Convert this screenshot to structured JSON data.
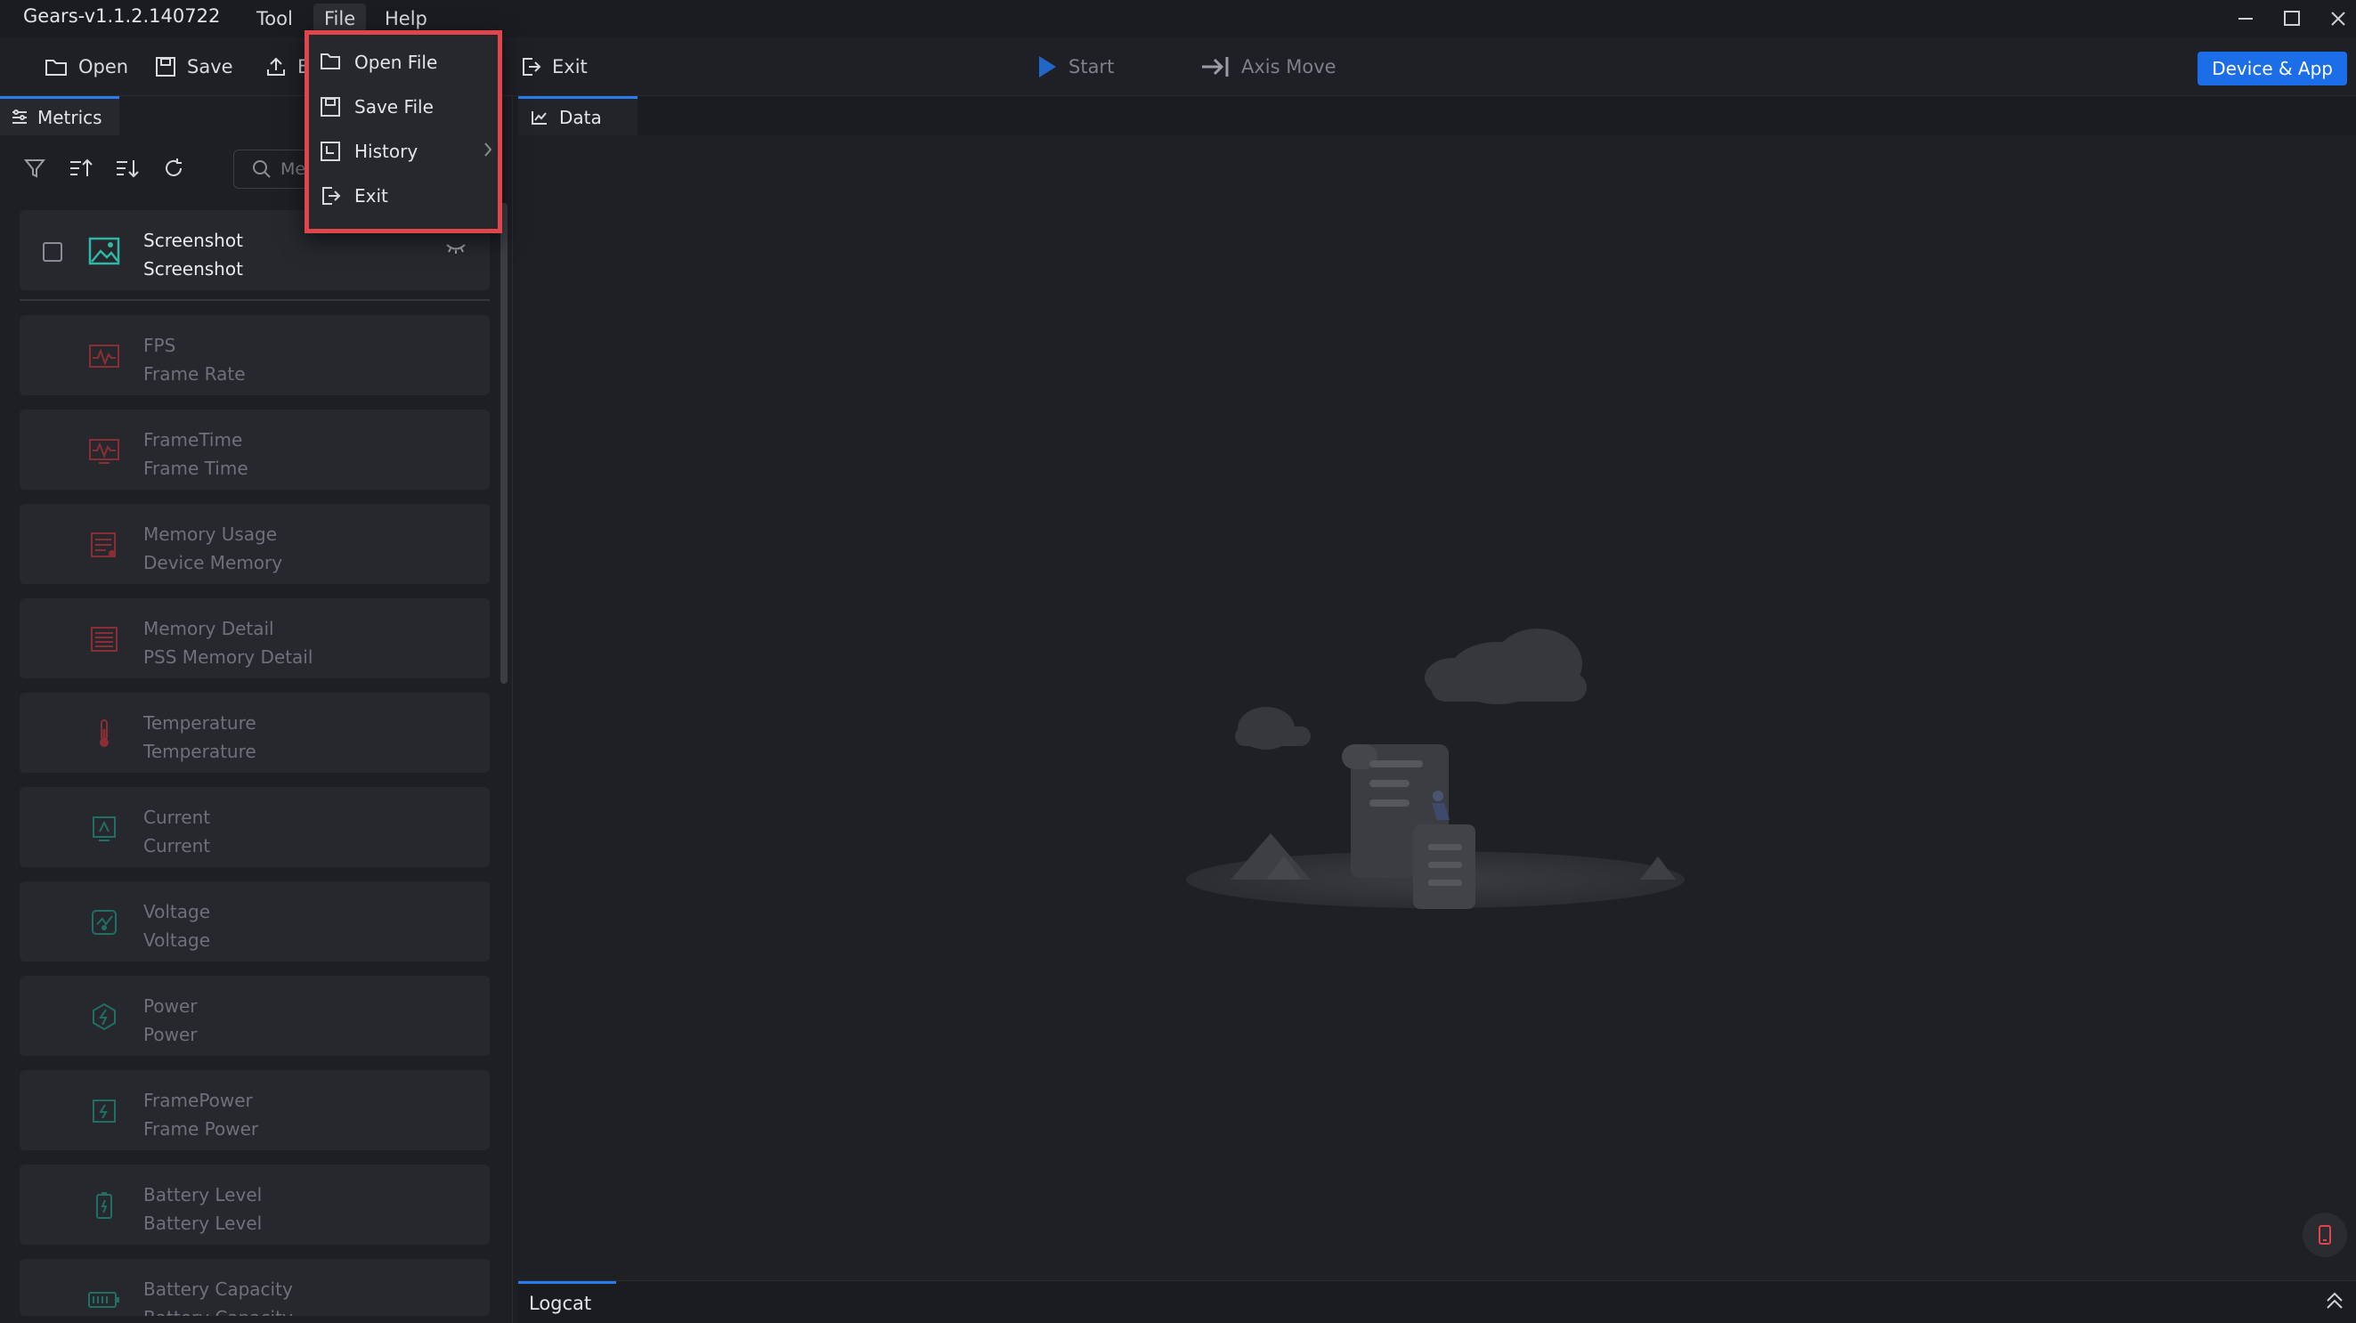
{
  "window": {
    "title": "Gears-v1.1.2.140722",
    "menus": [
      "Tool",
      "File",
      "Help"
    ],
    "active_menu": "File"
  },
  "toolbar": {
    "open": "Open",
    "save": "Save",
    "export_partial": "E",
    "exit": "Exit",
    "start": "Start",
    "axis_move": "Axis Move",
    "device_app": "Device & App"
  },
  "file_menu": {
    "items": [
      {
        "label": "Open File",
        "icon": "folder-icon"
      },
      {
        "label": "Save File",
        "icon": "save-icon"
      },
      {
        "label": "History",
        "icon": "history-icon",
        "has_submenu": true
      },
      {
        "label": "Exit",
        "icon": "exit-icon"
      }
    ]
  },
  "metrics_panel": {
    "tab_label": "Metrics",
    "search_placeholder": "Me",
    "items": [
      {
        "title": "Screenshot",
        "subtitle": "Screenshot",
        "enabled": true,
        "color": "#2fb8a6"
      },
      {
        "title": "FPS",
        "subtitle": "Frame Rate",
        "enabled": false,
        "color": "#c0444c"
      },
      {
        "title": "FrameTime",
        "subtitle": "Frame Time",
        "enabled": false,
        "color": "#c0444c"
      },
      {
        "title": "Memory Usage",
        "subtitle": "Device Memory",
        "enabled": false,
        "color": "#c0444c"
      },
      {
        "title": "Memory Detail",
        "subtitle": "PSS Memory Detail",
        "enabled": false,
        "color": "#c0444c"
      },
      {
        "title": "Temperature",
        "subtitle": "Temperature",
        "enabled": false,
        "color": "#c0444c"
      },
      {
        "title": "Current",
        "subtitle": "Current",
        "enabled": false,
        "color": "#1f8f80"
      },
      {
        "title": "Voltage",
        "subtitle": "Voltage",
        "enabled": false,
        "color": "#1f8f80"
      },
      {
        "title": "Power",
        "subtitle": "Power",
        "enabled": false,
        "color": "#1f8f80"
      },
      {
        "title": "FramePower",
        "subtitle": "Frame Power",
        "enabled": false,
        "color": "#1f8f80"
      },
      {
        "title": "Battery Level",
        "subtitle": "Battery Level",
        "enabled": false,
        "color": "#1f8f80"
      },
      {
        "title": "Battery Capacity",
        "subtitle": "Battery Capacity",
        "enabled": false,
        "color": "#1f8f80"
      }
    ]
  },
  "main": {
    "data_tab": "Data",
    "logcat_tab": "Logcat"
  },
  "colors": {
    "accent": "#1c6ee8",
    "highlight_border": "#e0454b"
  }
}
